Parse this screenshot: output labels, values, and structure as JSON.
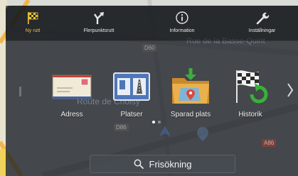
{
  "toolbar": {
    "items": [
      {
        "label": "Ny rutt",
        "icon": "checkered-flag-icon",
        "active": true
      },
      {
        "label": "Flerpunktsrutt",
        "icon": "fork-arrow-icon",
        "active": false
      },
      {
        "label": "Information",
        "icon": "info-icon",
        "active": false
      },
      {
        "label": "Inställningar",
        "icon": "wrench-icon",
        "active": false
      }
    ]
  },
  "map_labels": {
    "street_1": "Rue de la Basse-Quint",
    "street_2": "Route de Choisy",
    "road_d60": "D60",
    "road_d86": "D86",
    "road_a86": "A86"
  },
  "tiles": [
    {
      "label": "Adress",
      "icon": "envelope-icon"
    },
    {
      "label": "Platser",
      "icon": "places-sign-icon"
    },
    {
      "label": "Sparad plats",
      "icon": "saved-place-folder-icon"
    },
    {
      "label": "Historik",
      "icon": "history-flag-icon"
    }
  ],
  "pager": {
    "pages": 2,
    "current": 1
  },
  "search": {
    "label": "Frisökning",
    "icon": "search-icon"
  },
  "colors": {
    "accent": "#f2c230",
    "background": "#2a2f35",
    "search_bg": "#464c52"
  }
}
